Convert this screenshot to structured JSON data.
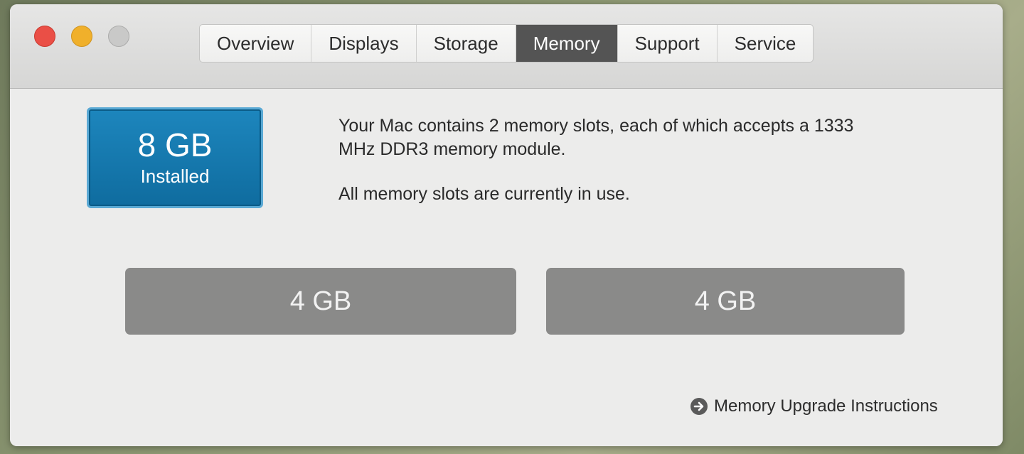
{
  "window": {
    "controls": {
      "close": "close-button",
      "minimize": "minimize-button",
      "zoom": "zoom-button"
    },
    "tabs": [
      {
        "label": "Overview",
        "active": false
      },
      {
        "label": "Displays",
        "active": false
      },
      {
        "label": "Storage",
        "active": false
      },
      {
        "label": "Memory",
        "active": true
      },
      {
        "label": "Support",
        "active": false
      },
      {
        "label": "Service",
        "active": false
      }
    ]
  },
  "memory": {
    "installed_size": "8 GB",
    "installed_label": "Installed",
    "description": "Your Mac contains 2 memory slots, each of which accepts a 1333 MHz DDR3 memory module.",
    "status": "All memory slots are currently in use.",
    "slots": [
      {
        "label": "4 GB"
      },
      {
        "label": "4 GB"
      }
    ],
    "upgrade_link": "Memory Upgrade Instructions"
  },
  "colors": {
    "accent_blue": "#1679b0",
    "active_tab": "#545454",
    "slot_fill": "#8a8a89",
    "close": "#ea4f46",
    "minimize": "#f0b02b"
  },
  "icons": {
    "upgrade_link_icon": "arrow-circle-right-icon"
  }
}
